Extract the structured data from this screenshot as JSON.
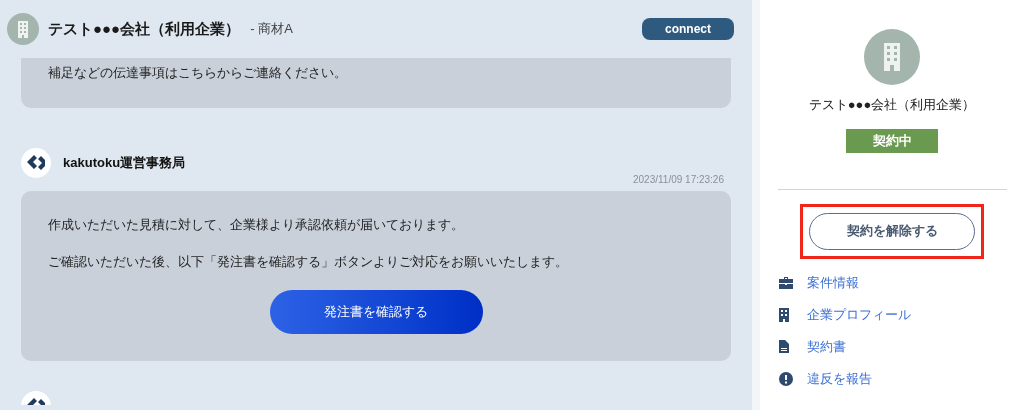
{
  "header": {
    "company": "テスト●●●会社（利用企業）",
    "subtitle": "- 商材A",
    "connect_button": "connect"
  },
  "messages": [
    {
      "kind": "continued",
      "paragraphs": [
        "補足などの伝達事項はこちらからご連絡ください。"
      ]
    },
    {
      "kind": "full",
      "sender": "kakutoku運営事務局",
      "time": "2023/11/09 17:23:26",
      "paragraphs": [
        "作成いただいた見積に対して、企業様より承認依頼が届いております。",
        "ご確認いただいた後、以下「発注書を確認する」ボタンよりご対応をお願いいたします。"
      ],
      "action": "発注書を確認する"
    },
    {
      "kind": "avatar_only"
    }
  ],
  "sidebar": {
    "company": "テスト●●●会社（利用企業）",
    "status": "契約中",
    "cancel_button": {
      "label": "契約を解除する",
      "highlighted": true
    },
    "links": [
      {
        "kind": "briefcase",
        "label": "案件情報"
      },
      {
        "kind": "building",
        "label": "企業プロフィール"
      },
      {
        "kind": "document",
        "label": "契約書"
      },
      {
        "kind": "alert",
        "label": "違反を報告"
      }
    ]
  }
}
